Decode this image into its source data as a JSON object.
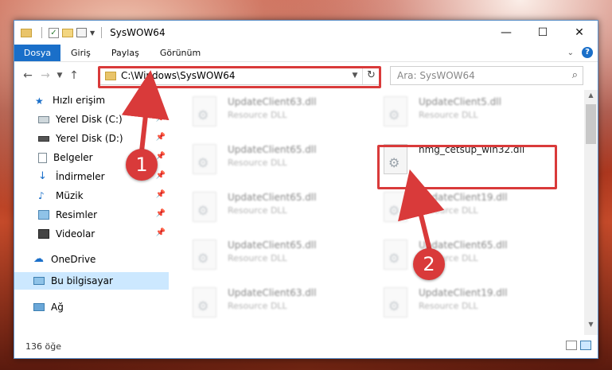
{
  "window": {
    "title": "SysWOW64"
  },
  "ribbon": {
    "tabs": [
      "Dosya",
      "Giriş",
      "Paylaş",
      "Görünüm"
    ]
  },
  "address": {
    "path": "C:\\Windows\\SysWOW64",
    "search_placeholder": "Ara: SysWOW64"
  },
  "sidebar": {
    "quick_access": "Hızlı erişim",
    "items": [
      {
        "label": "Yerel Disk (C:)",
        "icon": "drive-icon"
      },
      {
        "label": "Yerel Disk (D:)",
        "icon": "drive-icon"
      },
      {
        "label": "Belgeler",
        "icon": "documents-icon"
      },
      {
        "label": "İndirmeler",
        "icon": "download-icon"
      },
      {
        "label": "Müzik",
        "icon": "music-icon"
      },
      {
        "label": "Resimler",
        "icon": "pictures-icon"
      },
      {
        "label": "Videolar",
        "icon": "videos-icon"
      }
    ],
    "onedrive": "OneDrive",
    "this_pc": "Bu bilgisayar",
    "network": "Ağ"
  },
  "files": [
    {
      "name": "UpdateClient63.dll",
      "type": "Resource DLL"
    },
    {
      "name": "UpdateClient5.dll",
      "type": "Resource DLL"
    },
    {
      "name": "UpdateClient65.dll",
      "type": "Resource DLL"
    },
    {
      "name": "hmg_cetsup_win32.dll",
      "type": ""
    },
    {
      "name": "UpdateClient65.dll",
      "type": "Resource DLL"
    },
    {
      "name": "UpdateClient19.dll",
      "type": "Resource DLL"
    },
    {
      "name": "UpdateClient65.dll",
      "type": "Resource DLL"
    },
    {
      "name": "UpdateClient65.dll",
      "type": "Resource DLL"
    },
    {
      "name": "UpdateClient63.dll",
      "type": "Resource DLL"
    },
    {
      "name": "UpdateClient19.dll",
      "type": "Resource DLL"
    }
  ],
  "status": {
    "count": "136 öğe"
  },
  "callouts": [
    "1",
    "2"
  ],
  "colors": {
    "accent": "#1a6fc9",
    "highlight": "#d93a3a",
    "selected": "#cce8ff"
  }
}
